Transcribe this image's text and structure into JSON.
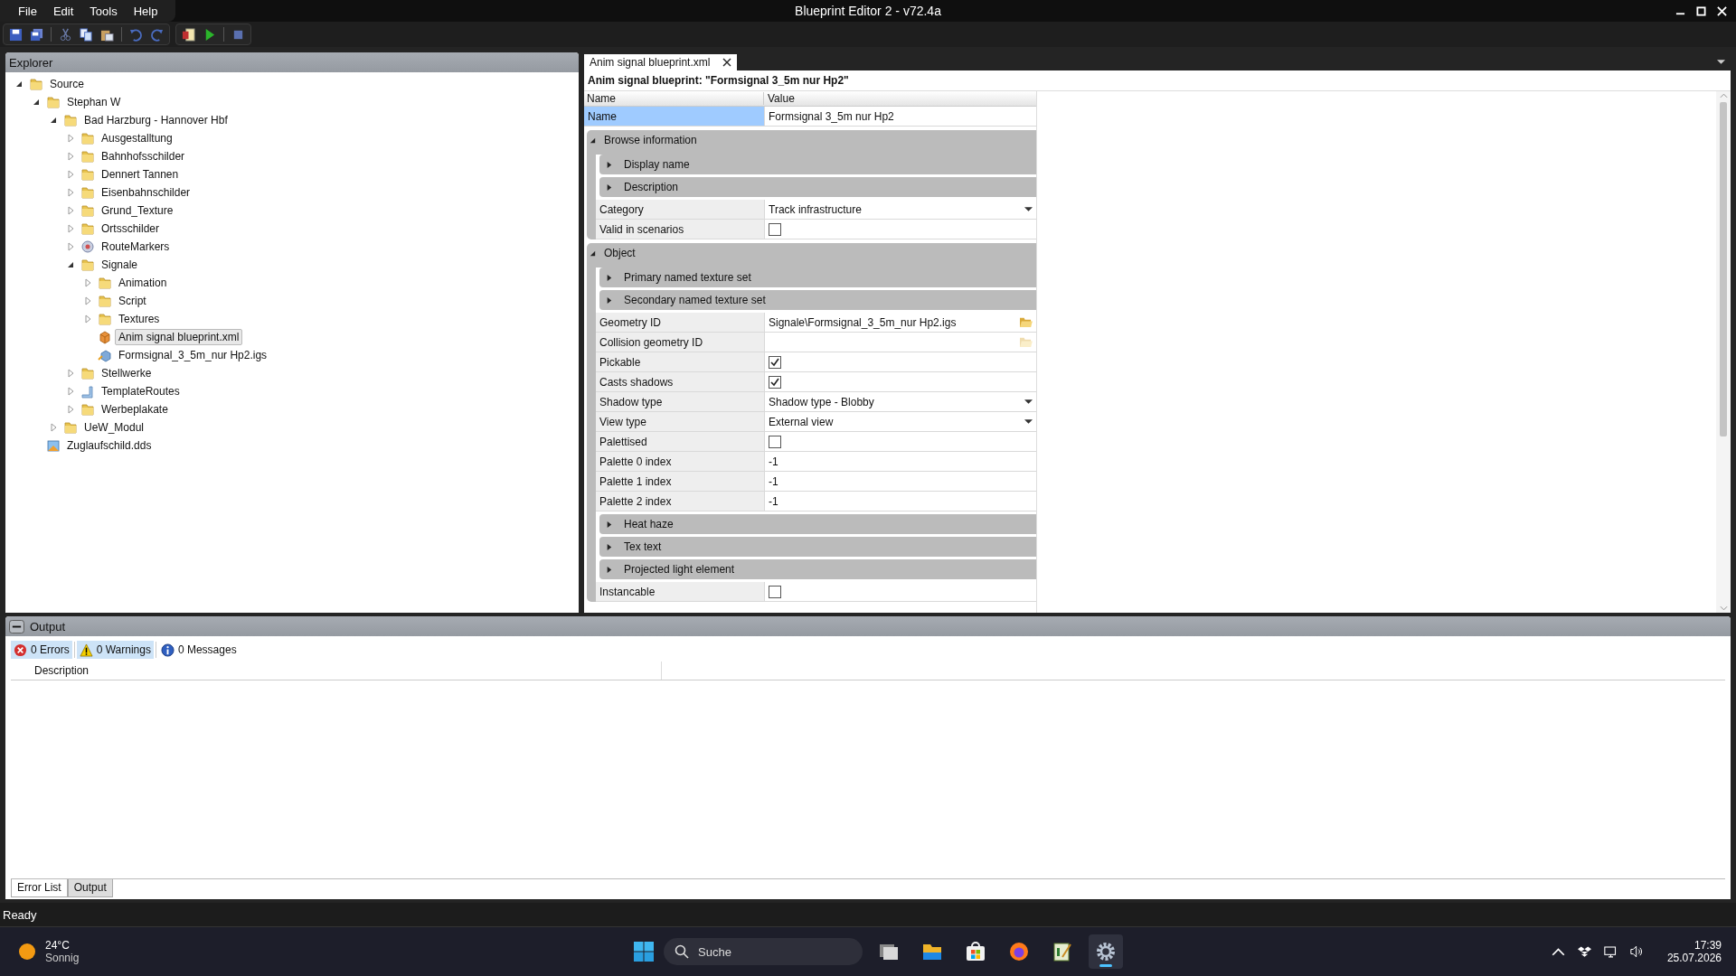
{
  "window": {
    "title": "Blueprint Editor 2 - v72.4a",
    "menu": [
      "File",
      "Edit",
      "Tools",
      "Help"
    ]
  },
  "explorer": {
    "title": "Explorer",
    "tree": [
      {
        "label": "Source",
        "kind": "folder",
        "expanded": true,
        "selected": false,
        "children": [
          {
            "label": "Stephan W",
            "kind": "folder",
            "expanded": true,
            "selected": false,
            "children": [
              {
                "label": "Bad Harzburg - Hannover Hbf",
                "kind": "folder",
                "expanded": true,
                "selected": false,
                "children": [
                  {
                    "label": "Ausgestalltung",
                    "kind": "folder",
                    "expanded": false,
                    "selected": false
                  },
                  {
                    "label": "Bahnhofsschilder",
                    "kind": "folder",
                    "expanded": false,
                    "selected": false
                  },
                  {
                    "label": "Dennert Tannen",
                    "kind": "folder",
                    "expanded": false,
                    "selected": false
                  },
                  {
                    "label": "Eisenbahnschilder",
                    "kind": "folder",
                    "expanded": false,
                    "selected": false
                  },
                  {
                    "label": "Grund_Texture",
                    "kind": "folder",
                    "expanded": false,
                    "selected": false
                  },
                  {
                    "label": "Ortsschilder",
                    "kind": "folder",
                    "expanded": false,
                    "selected": false
                  },
                  {
                    "label": "RouteMarkers",
                    "kind": "markers",
                    "expanded": false,
                    "selected": false
                  },
                  {
                    "label": "Signale",
                    "kind": "folder",
                    "expanded": true,
                    "selected": false,
                    "children": [
                      {
                        "label": "Animation",
                        "kind": "folder",
                        "expanded": false,
                        "selected": false
                      },
                      {
                        "label": "Script",
                        "kind": "folder",
                        "expanded": false,
                        "selected": false
                      },
                      {
                        "label": "Textures",
                        "kind": "folder",
                        "expanded": false,
                        "selected": false
                      },
                      {
                        "label": "Anim signal blueprint.xml",
                        "kind": "blueprint",
                        "selected": true
                      },
                      {
                        "label": "Formsignal_3_5m_nur Hp2.igs",
                        "kind": "geometry",
                        "selected": false
                      }
                    ]
                  },
                  {
                    "label": "Stellwerke",
                    "kind": "folder",
                    "expanded": false,
                    "selected": false
                  },
                  {
                    "label": "TemplateRoutes",
                    "kind": "template",
                    "expanded": false,
                    "selected": false
                  },
                  {
                    "label": "Werbeplakate",
                    "kind": "folder",
                    "expanded": false,
                    "selected": false
                  }
                ]
              },
              {
                "label": "UeW_Modul",
                "kind": "folder",
                "expanded": false,
                "selected": false
              }
            ]
          },
          {
            "label": "Zuglaufschild.dds",
            "kind": "texture",
            "selected": false
          }
        ]
      }
    ]
  },
  "document": {
    "tabs": [
      {
        "label": "Anim signal blueprint.xml",
        "selected": true
      }
    ],
    "heading": "Anim signal blueprint: \"Formsignal 3_5m nur Hp2\"",
    "columns": [
      "Name",
      "Value"
    ],
    "properties": [
      {
        "kind": "text",
        "label": "Name",
        "value": "Formsignal 3_5m nur Hp2",
        "selected": true
      },
      {
        "kind": "category",
        "label": "Browse information",
        "expanded": true,
        "children": [
          {
            "kind": "subcategory",
            "label": "Display name",
            "expanded": false
          },
          {
            "kind": "subcategory",
            "label": "Description",
            "expanded": false
          },
          {
            "kind": "dropdown",
            "label": "Category",
            "value": "Track infrastructure",
            "selected": false
          },
          {
            "kind": "checkbox",
            "label": "Valid in scenarios",
            "checked": false,
            "selected": false
          }
        ]
      },
      {
        "kind": "category",
        "label": "Object",
        "expanded": true,
        "children": [
          {
            "kind": "subcategory",
            "label": "Primary named texture set",
            "expanded": false
          },
          {
            "kind": "subcategory",
            "label": "Secondary named texture set",
            "expanded": false
          },
          {
            "kind": "file",
            "label": "Geometry ID",
            "value": "Signale\\Formsignal_3_5m_nur Hp2.igs",
            "selected": false
          },
          {
            "kind": "file",
            "label": "Collision geometry ID",
            "selected": false
          },
          {
            "kind": "checkbox",
            "label": "Pickable",
            "checked": true,
            "selected": false
          },
          {
            "kind": "checkbox",
            "label": "Casts shadows",
            "checked": true,
            "selected": false
          },
          {
            "kind": "dropdown",
            "label": "Shadow type",
            "value": "Shadow type - Blobby",
            "selected": false
          },
          {
            "kind": "dropdown",
            "label": "View type",
            "value": "External view",
            "selected": false
          },
          {
            "kind": "checkbox",
            "label": "Palettised",
            "checked": false,
            "selected": false
          },
          {
            "kind": "text",
            "label": "Palette 0 index",
            "value": "-1",
            "selected": false
          },
          {
            "kind": "text",
            "label": "Palette 1 index",
            "value": "-1",
            "selected": false
          },
          {
            "kind": "text",
            "label": "Palette 2 index",
            "value": "-1",
            "selected": false
          },
          {
            "kind": "subcategory",
            "label": "Heat haze",
            "expanded": false
          },
          {
            "kind": "subcategory",
            "label": "Tex text",
            "expanded": false
          },
          {
            "kind": "subcategory",
            "label": "Projected light element",
            "expanded": false
          },
          {
            "kind": "checkbox",
            "label": "Instancable",
            "checked": false,
            "selected": false
          }
        ]
      }
    ]
  },
  "output": {
    "title": "Output",
    "filters": [
      {
        "kind": "error",
        "label": "0 Errors",
        "selected": true
      },
      {
        "kind": "warning",
        "label": "0 Warnings",
        "selected": true
      },
      {
        "kind": "info",
        "label": "0 Messages",
        "selected": false
      }
    ],
    "columns": [
      "Description"
    ],
    "tabs": [
      {
        "label": "Error List",
        "selected": true
      },
      {
        "label": "Output",
        "selected": false
      }
    ]
  },
  "status_bar": "Ready",
  "taskbar": {
    "temperature": "24°C",
    "condition": "Sonnig",
    "search": {
      "placeholder": "Suche"
    },
    "apps": [
      {
        "kind": "taskview",
        "active": false
      },
      {
        "kind": "files",
        "active": false
      },
      {
        "kind": "store",
        "active": false
      },
      {
        "kind": "browser",
        "active": false
      },
      {
        "kind": "notes",
        "active": false
      },
      {
        "kind": "gear",
        "active": true
      }
    ],
    "time": "17:39",
    "date": "25.07.2026"
  }
}
